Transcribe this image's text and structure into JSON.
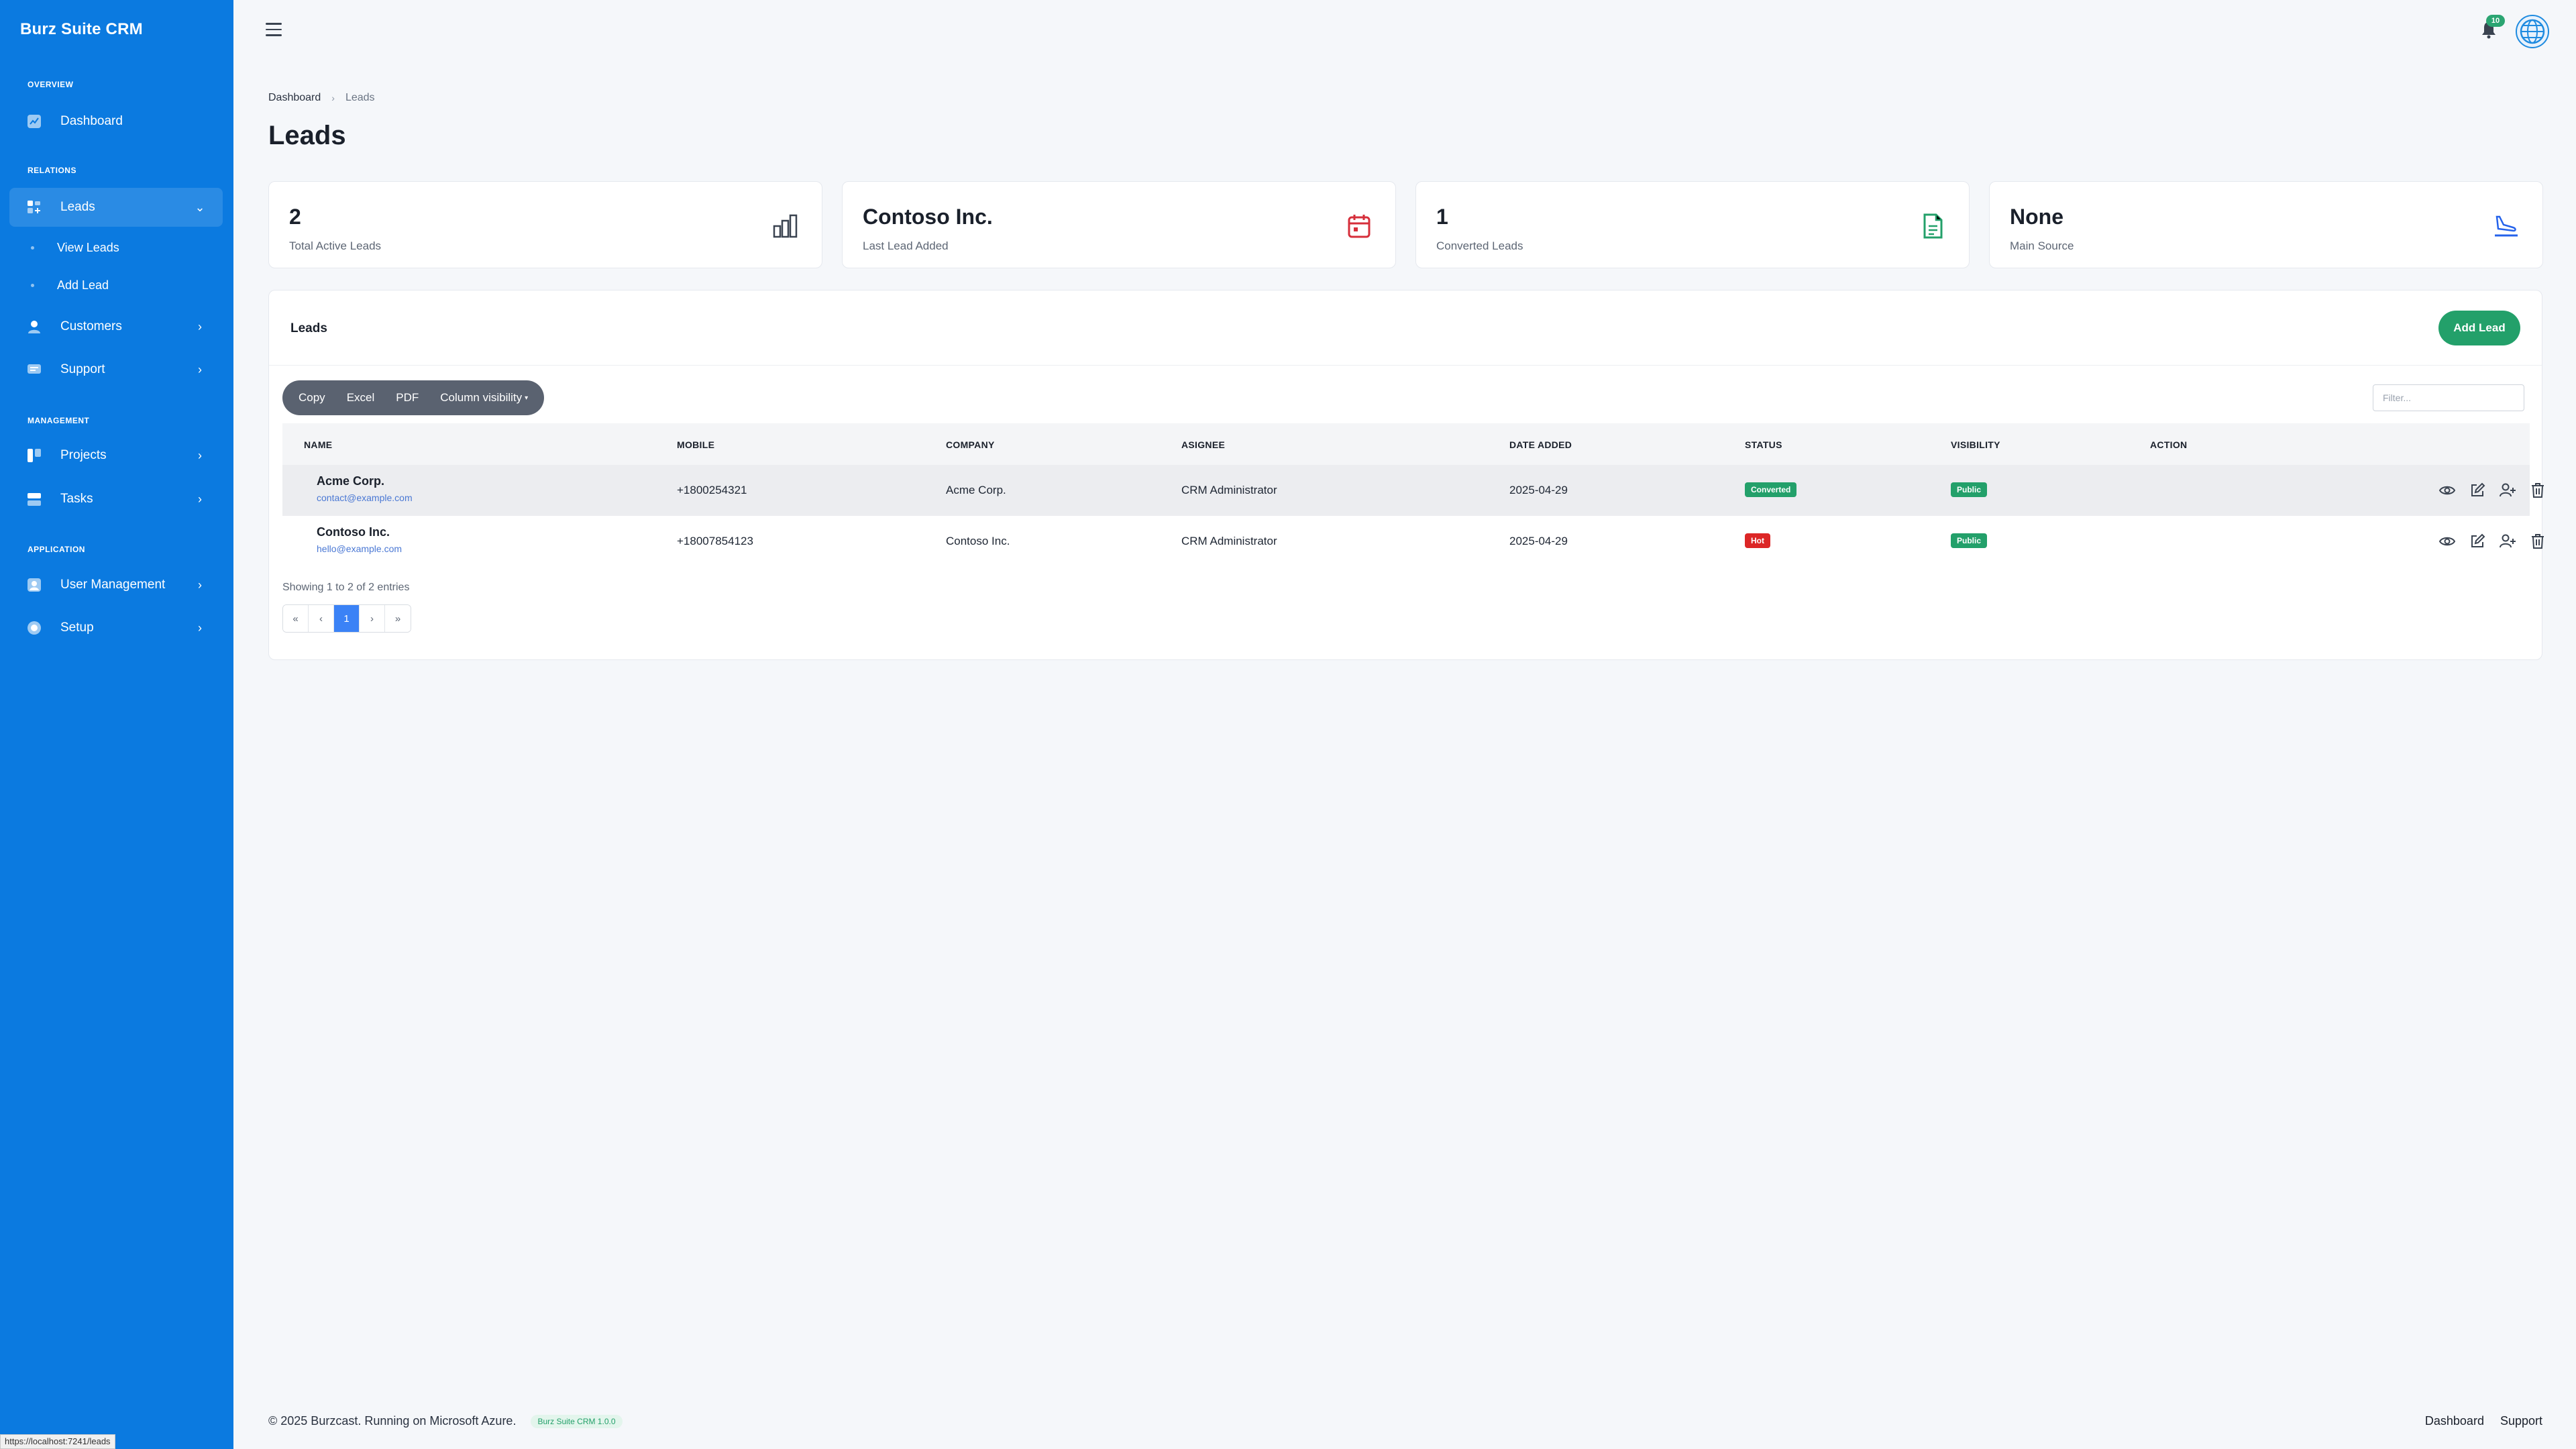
{
  "app": {
    "brand": "Burz Suite CRM"
  },
  "sidebar": {
    "sections": {
      "overview": "OVERVIEW",
      "relations": "RELATIONS",
      "management": "MANAGEMENT",
      "application": "APPLICATION"
    },
    "items": {
      "dashboard": "Dashboard",
      "leads": "Leads",
      "view_leads": "View Leads",
      "add_lead": "Add Lead",
      "customers": "Customers",
      "support": "Support",
      "projects": "Projects",
      "tasks": "Tasks",
      "user_management": "User Management",
      "setup": "Setup"
    }
  },
  "topbar": {
    "notification_count": "10"
  },
  "breadcrumb": {
    "root": "Dashboard",
    "current": "Leads"
  },
  "page": {
    "title": "Leads"
  },
  "stats": [
    {
      "value": "2",
      "label": "Total Active Leads",
      "icon": "bar-chart-icon",
      "color": "#3a4350"
    },
    {
      "value": "Contoso Inc.",
      "label": "Last Lead Added",
      "icon": "calendar-icon",
      "color": "#d62f3b"
    },
    {
      "value": "1",
      "label": "Converted Leads",
      "icon": "document-icon",
      "color": "#23a06a"
    },
    {
      "value": "None",
      "label": "Main Source",
      "icon": "plane-landing-icon",
      "color": "#2563eb"
    }
  ],
  "panel": {
    "title": "Leads",
    "add_button": "Add Lead",
    "export_buttons": {
      "copy": "Copy",
      "excel": "Excel",
      "pdf": "PDF",
      "colvis": "Column visibility"
    },
    "filter_placeholder": "Filter..."
  },
  "table": {
    "headers": {
      "name": "NAME",
      "mobile": "MOBILE",
      "company": "COMPANY",
      "assignee": "ASIGNEE",
      "date": "DATE ADDED",
      "status": "STATUS",
      "visibility": "VISIBILITY",
      "action": "ACTION"
    },
    "rows": [
      {
        "name": "Acme Corp.",
        "email": "contact@example.com",
        "mobile": "+1800254321",
        "company": "Acme Corp.",
        "assignee": "CRM Administrator",
        "date": "2025-04-29",
        "status": "Converted",
        "status_color": "#23a06a",
        "visibility": "Public"
      },
      {
        "name": "Contoso Inc.",
        "email": "hello@example.com",
        "mobile": "+18007854123",
        "company": "Contoso Inc.",
        "assignee": "CRM Administrator",
        "date": "2025-04-29",
        "status": "Hot",
        "status_color": "#dc2626",
        "visibility": "Public"
      }
    ],
    "showing": "Showing 1 to 2 of 2 entries",
    "pager": {
      "first": "«",
      "prev": "‹",
      "current": "1",
      "next": "›",
      "last": "»"
    }
  },
  "footer": {
    "text": "© 2025 Burzcast. Running on Microsoft Azure.",
    "version": "Burz Suite CRM 1.0.0",
    "links": {
      "dashboard": "Dashboard",
      "support": "Support"
    }
  },
  "status_url": "https://localhost:7241/leads"
}
